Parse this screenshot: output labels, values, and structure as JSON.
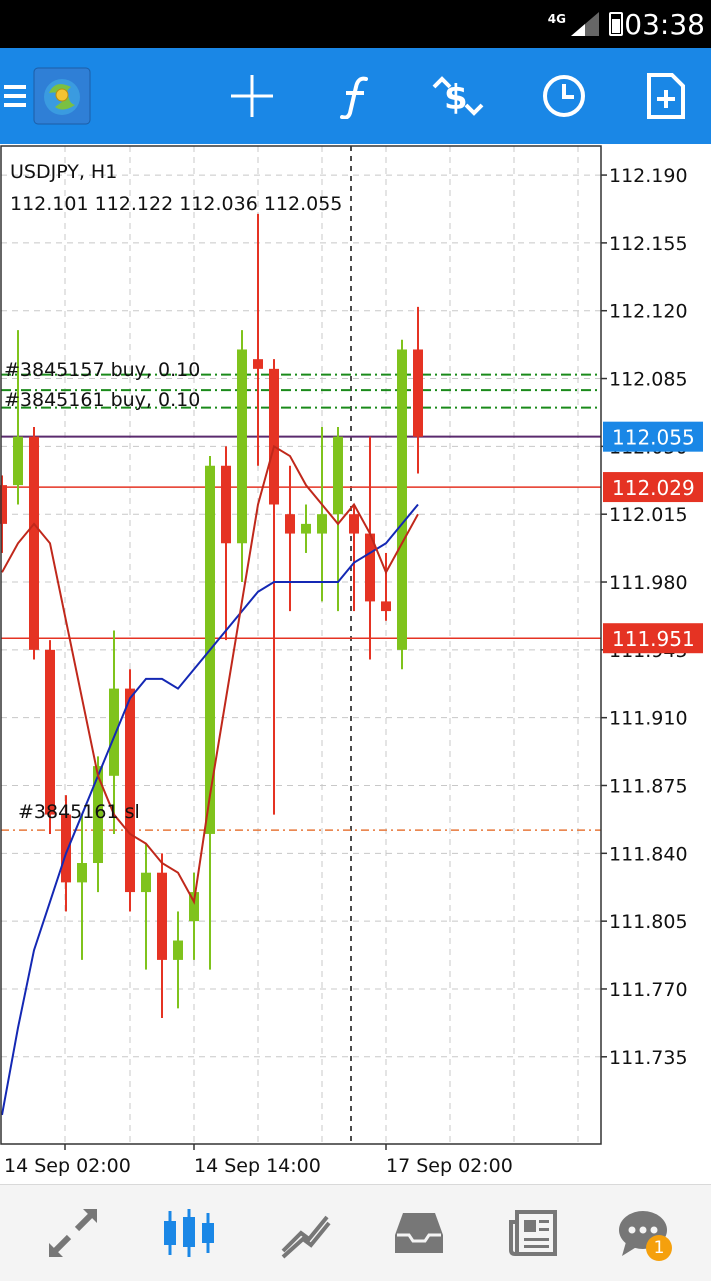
{
  "status_bar": {
    "time": "03:38",
    "network": "4G"
  },
  "toolbar": {
    "buttons": [
      {
        "name": "app-logo-icon"
      },
      {
        "name": "crosshair-icon"
      },
      {
        "name": "indicators-icon"
      },
      {
        "name": "trade-icon"
      },
      {
        "name": "timeframe-icon"
      },
      {
        "name": "add-symbol-icon"
      }
    ]
  },
  "chart": {
    "symbol_label": "USDJPY, H1",
    "ohlc_label": "112.101 112.122 112.036 112.055",
    "price_labels": [
      "112.190",
      "112.155",
      "112.120",
      "112.085",
      "112.050",
      "112.015",
      "111.980",
      "111.945",
      "111.910",
      "111.875",
      "111.840",
      "111.805",
      "111.770",
      "111.735"
    ],
    "time_labels": [
      "14 Sep 02:00",
      "14 Sep 14:00",
      "17 Sep 02:00"
    ],
    "order_labels": [
      "#3845157 buy, 0.10",
      "#3845161 buy, 0.10",
      "#3845161 sl"
    ],
    "bid_label": "112.055",
    "line_labels": [
      "112.029",
      "111.951"
    ]
  },
  "chart_data": {
    "type": "candlestick",
    "symbol": "USDJPY",
    "timeframe": "H1",
    "ylim": [
      111.69,
      112.205
    ],
    "candles": [
      {
        "o": 112.01,
        "h": 112.035,
        "l": 111.995,
        "c": 112.03,
        "bull": false
      },
      {
        "o": 112.055,
        "h": 112.11,
        "l": 112.02,
        "c": 112.03,
        "bull": true
      },
      {
        "o": 112.055,
        "h": 112.06,
        "l": 111.94,
        "c": 111.945,
        "bull": false
      },
      {
        "o": 111.945,
        "h": 111.95,
        "l": 111.85,
        "c": 111.86,
        "bull": false
      },
      {
        "o": 111.86,
        "h": 111.87,
        "l": 111.81,
        "c": 111.825,
        "bull": false
      },
      {
        "o": 111.825,
        "h": 111.86,
        "l": 111.785,
        "c": 111.835,
        "bull": true
      },
      {
        "o": 111.835,
        "h": 111.89,
        "l": 111.82,
        "c": 111.885,
        "bull": true
      },
      {
        "o": 111.88,
        "h": 111.955,
        "l": 111.85,
        "c": 111.925,
        "bull": true
      },
      {
        "o": 111.925,
        "h": 111.935,
        "l": 111.81,
        "c": 111.82,
        "bull": false
      },
      {
        "o": 111.82,
        "h": 111.845,
        "l": 111.78,
        "c": 111.83,
        "bull": true
      },
      {
        "o": 111.83,
        "h": 111.84,
        "l": 111.755,
        "c": 111.785,
        "bull": false
      },
      {
        "o": 111.785,
        "h": 111.81,
        "l": 111.76,
        "c": 111.795,
        "bull": true
      },
      {
        "o": 111.805,
        "h": 111.83,
        "l": 111.785,
        "c": 111.82,
        "bull": true
      },
      {
        "o": 111.85,
        "h": 112.045,
        "l": 111.78,
        "c": 112.04,
        "bull": true
      },
      {
        "o": 112.04,
        "h": 112.05,
        "l": 111.95,
        "c": 112.0,
        "bull": false
      },
      {
        "o": 112.0,
        "h": 112.11,
        "l": 111.98,
        "c": 112.1,
        "bull": true
      },
      {
        "o": 112.095,
        "h": 112.17,
        "l": 112.04,
        "c": 112.09,
        "bull": false
      },
      {
        "o": 112.09,
        "h": 112.095,
        "l": 111.86,
        "c": 112.02,
        "bull": false
      },
      {
        "o": 112.015,
        "h": 112.04,
        "l": 111.965,
        "c": 112.005,
        "bull": false
      },
      {
        "o": 112.005,
        "h": 112.02,
        "l": 111.995,
        "c": 112.01,
        "bull": true
      },
      {
        "o": 112.005,
        "h": 112.06,
        "l": 111.97,
        "c": 112.015,
        "bull": true
      },
      {
        "o": 112.015,
        "h": 112.06,
        "l": 111.965,
        "c": 112.055,
        "bull": true
      },
      {
        "o": 112.015,
        "h": 112.02,
        "l": 111.965,
        "c": 112.005,
        "bull": false
      },
      {
        "o": 112.005,
        "h": 112.055,
        "l": 111.94,
        "c": 111.97,
        "bull": false
      },
      {
        "o": 111.97,
        "h": 111.995,
        "l": 111.96,
        "c": 111.965,
        "bull": false
      },
      {
        "o": 111.945,
        "h": 112.105,
        "l": 111.935,
        "c": 112.1,
        "bull": true
      },
      {
        "o": 112.1,
        "h": 112.122,
        "l": 112.036,
        "c": 112.055,
        "bull": false
      }
    ],
    "ma_fast": [
      111.985,
      112.0,
      112.01,
      112.0,
      111.96,
      111.92,
      111.88,
      111.86,
      111.85,
      111.845,
      111.835,
      111.83,
      111.815,
      111.87,
      111.92,
      111.97,
      112.02,
      112.05,
      112.045,
      112.03,
      112.02,
      112.01,
      112.02,
      112.005,
      111.985,
      112.0,
      112.015
    ],
    "ma_slow": [
      111.705,
      111.75,
      111.79,
      111.815,
      111.84,
      111.86,
      111.88,
      111.9,
      111.92,
      111.93,
      111.93,
      111.925,
      111.935,
      111.945,
      111.955,
      111.965,
      111.975,
      111.98,
      111.98,
      111.98,
      111.98,
      111.98,
      111.99,
      111.995,
      112.0,
      112.01,
      112.02
    ],
    "bid": 112.055,
    "order_lines": [
      112.087,
      112.079,
      112.07
    ],
    "sl_line": 111.852,
    "red_lines": [
      112.029,
      111.951
    ],
    "grid": true
  },
  "bottom_nav": [
    {
      "name": "quotes-tab-icon"
    },
    {
      "name": "charts-tab-icon"
    },
    {
      "name": "trade-tab-icon"
    },
    {
      "name": "history-tab-icon"
    },
    {
      "name": "news-tab-icon"
    },
    {
      "name": "messages-tab-icon",
      "badge": "1"
    }
  ],
  "colors": {
    "accent": "#1a87e6",
    "bull": "#7fc31c",
    "bear": "#e53323",
    "ma_fast": "#c0281b",
    "ma_slow": "#1428b4",
    "order": "#1a8a1a",
    "sl": "#e8783a",
    "bid_line": "#5a2a6e",
    "tab_active": "#1a87e6",
    "tab_inactive": "#777777"
  }
}
